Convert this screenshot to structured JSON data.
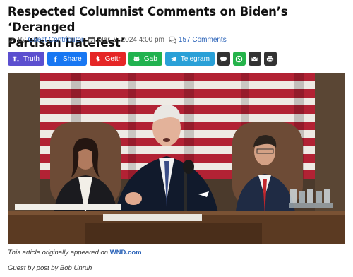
{
  "article": {
    "title_line1": "Respected Columnist Comments on Biden’s ‘Deranged",
    "title_line2": "Partisan Hatefest’",
    "author_prefix": "By",
    "author": "Guest Contributor",
    "date": "Mar. 8, 2024 4:00 pm",
    "comments": "157 Comments",
    "caption_prefix": "This article originally appeared on",
    "caption_link": "WND.com",
    "byline": "Guest by post by Bob Unruh"
  },
  "share": {
    "buttons": [
      {
        "label": "Truth",
        "color": "#5b4fcf",
        "icon": "truth-social-icon"
      },
      {
        "label": "Share",
        "color": "#1877f2",
        "icon": "facebook-icon"
      },
      {
        "label": "Gettr",
        "color": "#e52626",
        "icon": "gettr-icon"
      },
      {
        "label": "Gab",
        "color": "#21b24f",
        "icon": "gab-icon"
      },
      {
        "label": "Telegram",
        "color": "#2aa0d7",
        "icon": "telegram-icon"
      }
    ],
    "icon_buttons": [
      {
        "icon": "comment-icon",
        "color": "#333333"
      },
      {
        "icon": "whatsapp-icon",
        "color": "#25b34a"
      },
      {
        "icon": "email-icon",
        "color": "#333333"
      },
      {
        "icon": "print-icon",
        "color": "#333333"
      }
    ]
  },
  "colors": {
    "link": "#2b63b8",
    "title": "#111111",
    "flag_red": "#b22234"
  }
}
